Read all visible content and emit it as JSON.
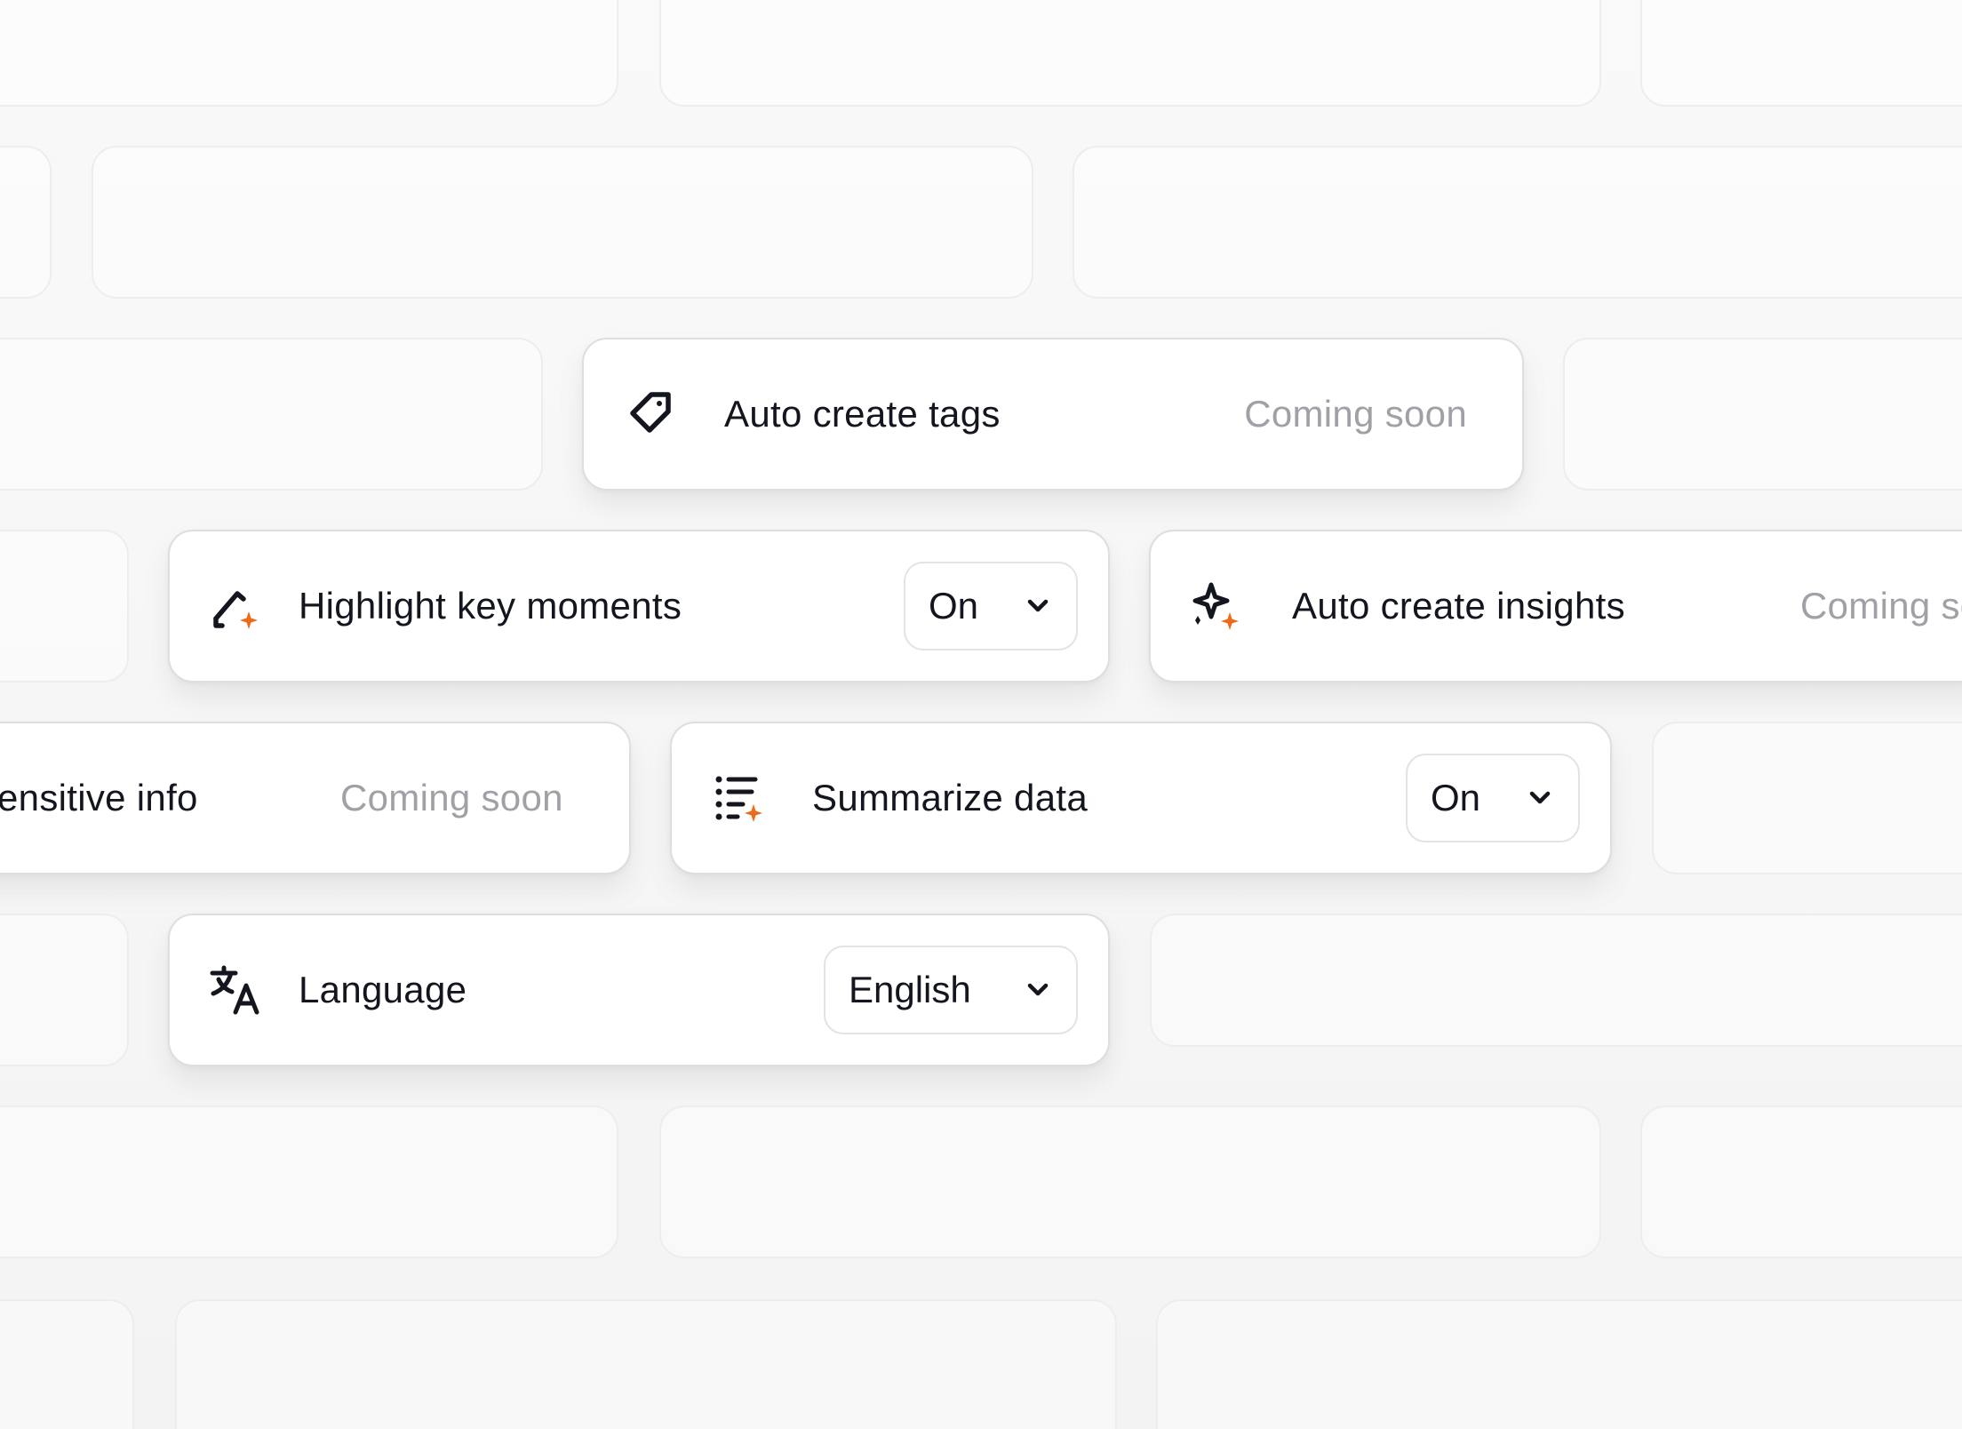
{
  "accent_color": "#ec6a1a",
  "ink_color": "#14161f",
  "muted_color": "#a0a1a6",
  "cards": {
    "tags": {
      "icon": "tag-icon",
      "label": "Auto create tags",
      "status": "Coming soon"
    },
    "highlight": {
      "icon": "pen-sparkle-icon",
      "label": "Highlight key moments",
      "value": "On"
    },
    "insights": {
      "icon": "sparkles-icon",
      "label": "Auto create insights",
      "status": "Coming soon"
    },
    "sensitive": {
      "icon": "",
      "label": "ensitive info",
      "status": "Coming soon"
    },
    "summarize": {
      "icon": "list-sparkle-icon",
      "label": "Summarize data",
      "value": "On"
    },
    "language": {
      "icon": "translate-icon",
      "label": "Language",
      "value": "English"
    }
  },
  "dropdown_icon": "chevron-down-icon"
}
